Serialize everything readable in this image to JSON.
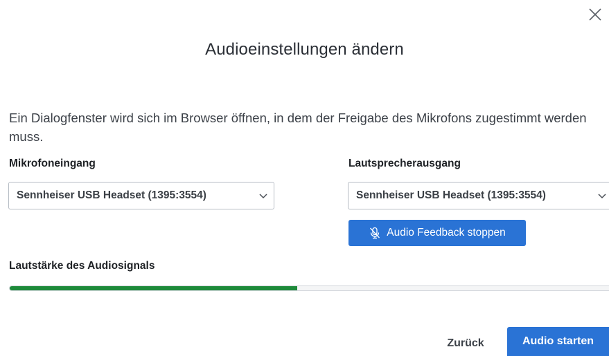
{
  "dialog": {
    "title": "Audioeinstellungen ändern",
    "info_text": "Ein Dialogfenster wird sich im Browser öffnen, in dem der Freigabe des Mikrofons zugestimmt werden muss.",
    "close_icon": "close-icon"
  },
  "microphone": {
    "label": "Mikrofoneingang",
    "selected": "Sennheiser USB Headset (1395:3554)"
  },
  "speaker": {
    "label": "Lautsprecherausgang",
    "selected": "Sennheiser USB Headset (1395:3554)",
    "feedback_button": "Audio Feedback stoppen",
    "feedback_icon": "microphone-muted-icon"
  },
  "volume": {
    "label": "Lautstärke des Audiosignals",
    "level_percent": 48,
    "fill_color": "#1e8a3a"
  },
  "footer": {
    "back_label": "Zurück",
    "start_label": "Audio starten"
  },
  "colors": {
    "primary": "#2a73d5"
  }
}
